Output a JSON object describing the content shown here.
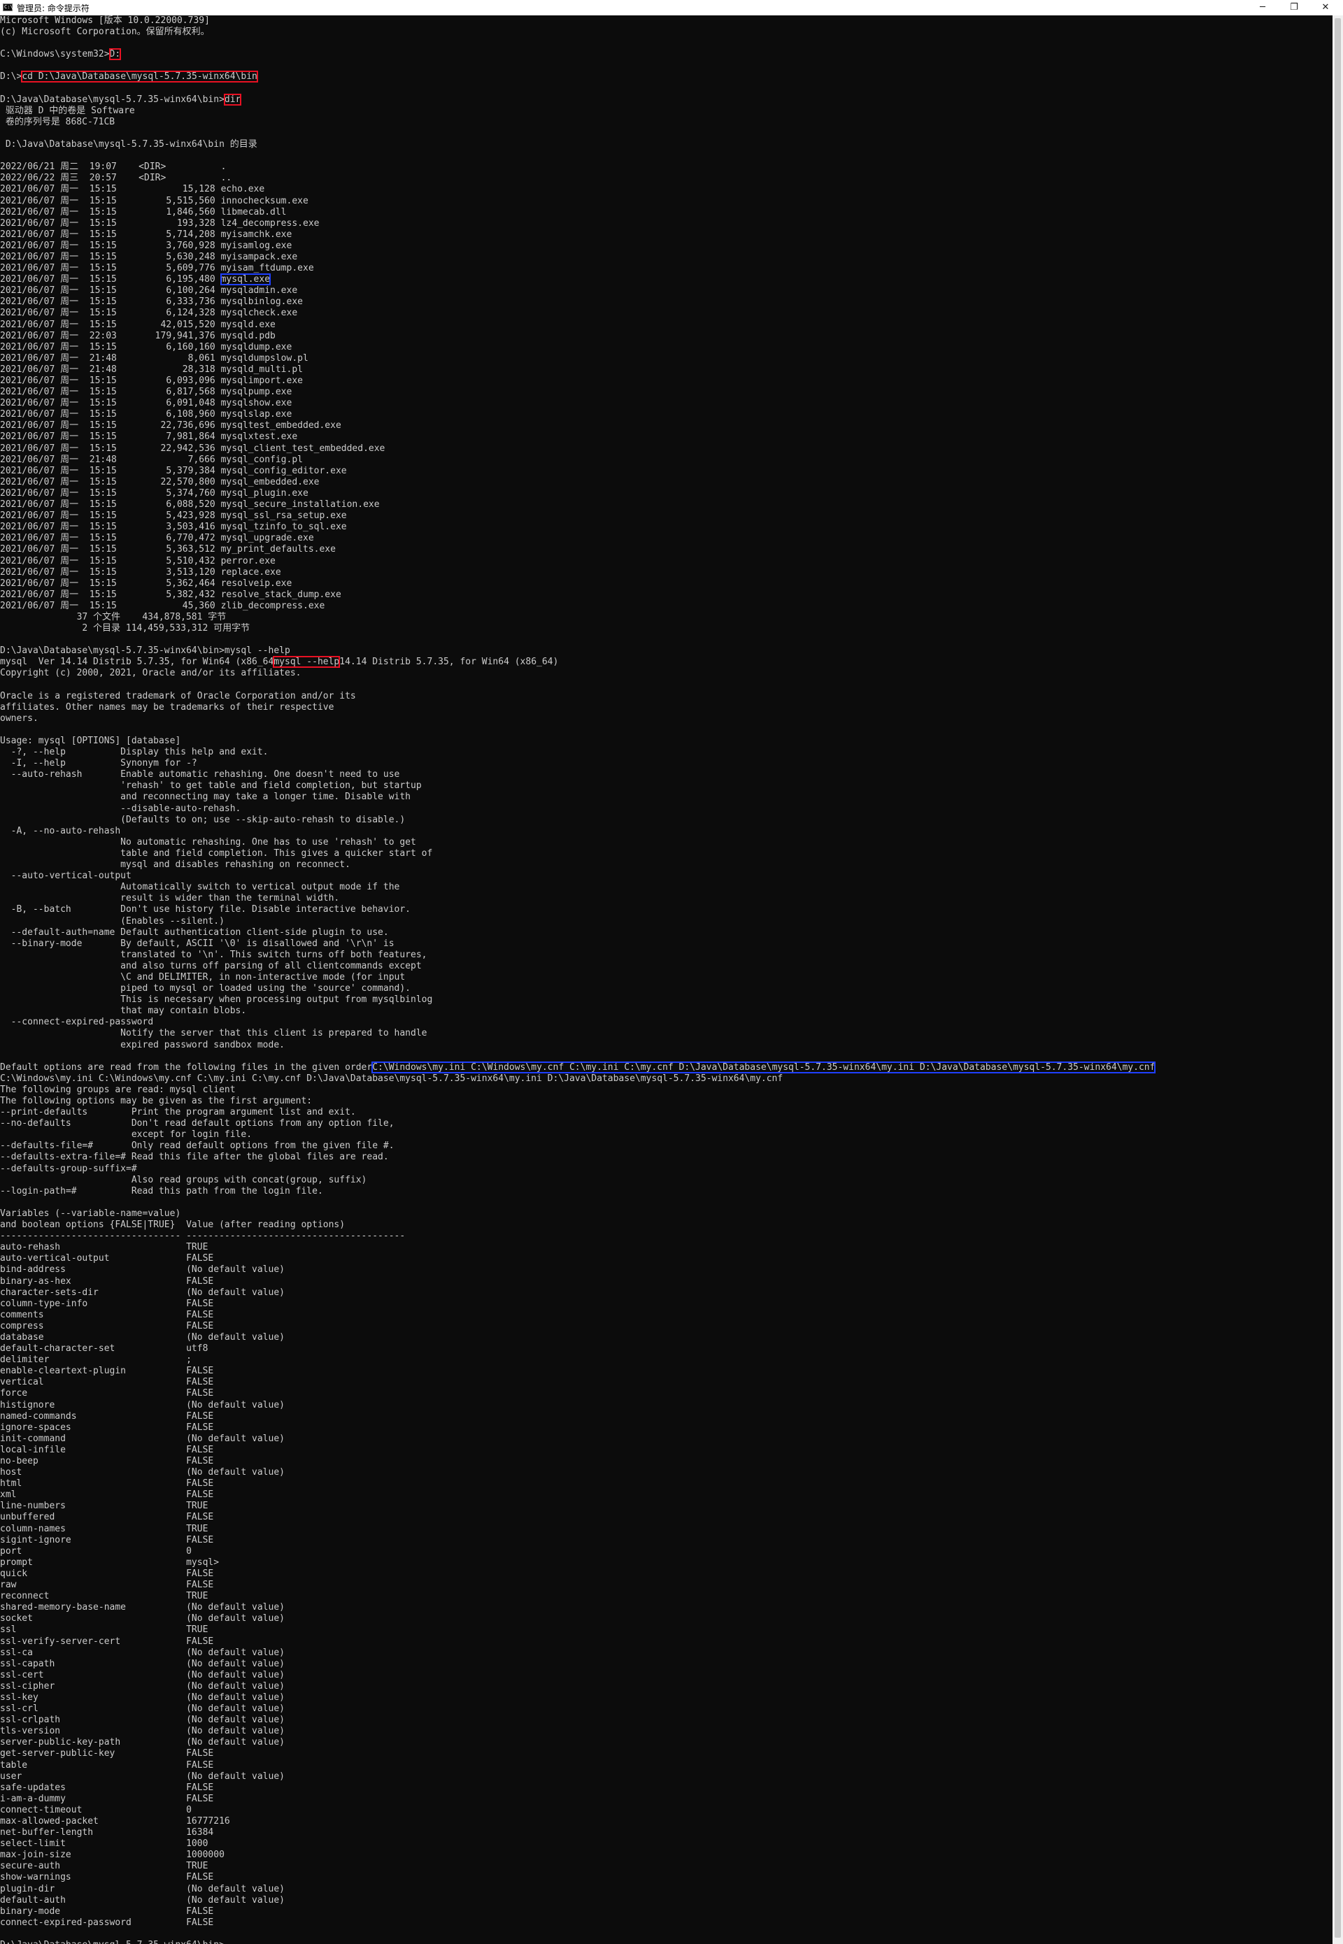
{
  "window": {
    "title": "管理员: 命令提示符",
    "icon_label": "C:\\",
    "minimize_glyph": "─",
    "maximize_glyph": "❐",
    "close_glyph": "✕"
  },
  "terminal": {
    "lines": [
      "Microsoft Windows [版本 10.0.22000.739]",
      "(c) Microsoft Corporation。保留所有权利。",
      "",
      "C:\\Windows\\system32>D:",
      "",
      "D:\\>cd D:\\Java\\Database\\mysql-5.7.35-winx64\\bin",
      "",
      "D:\\Java\\Database\\mysql-5.7.35-winx64\\bin>dir",
      " 驱动器 D 中的卷是 Software",
      " 卷的序列号是 868C-71CB",
      "",
      " D:\\Java\\Database\\mysql-5.7.35-winx64\\bin 的目录",
      "",
      "2022/06/21 周二  19:07    <DIR>          .",
      "2022/06/22 周三  20:57    <DIR>          ..",
      "2021/06/07 周一  15:15            15,128 echo.exe",
      "2021/06/07 周一  15:15         5,515,560 innochecksum.exe",
      "2021/06/07 周一  15:15         1,846,560 libmecab.dll",
      "2021/06/07 周一  15:15           193,328 lz4_decompress.exe",
      "2021/06/07 周一  15:15         5,714,208 myisamchk.exe",
      "2021/06/07 周一  15:15         3,760,928 myisamlog.exe",
      "2021/06/07 周一  15:15         5,630,248 myisampack.exe",
      "2021/06/07 周一  15:15         5,609,776 myisam_ftdump.exe",
      "2021/06/07 周一  15:15         6,195,480 mysql.exe",
      "2021/06/07 周一  15:15         6,100,264 mysqladmin.exe",
      "2021/06/07 周一  15:15         6,333,736 mysqlbinlog.exe",
      "2021/06/07 周一  15:15         6,124,328 mysqlcheck.exe",
      "2021/06/07 周一  15:15        42,015,520 mysqld.exe",
      "2021/06/07 周一  22:03       179,941,376 mysqld.pdb",
      "2021/06/07 周一  15:15         6,160,160 mysqldump.exe",
      "2021/06/07 周一  21:48             8,061 mysqldumpslow.pl",
      "2021/06/07 周一  21:48            28,318 mysqld_multi.pl",
      "2021/06/07 周一  15:15         6,093,096 mysqlimport.exe",
      "2021/06/07 周一  15:15         6,817,568 mysqlpump.exe",
      "2021/06/07 周一  15:15         6,091,048 mysqlshow.exe",
      "2021/06/07 周一  15:15         6,108,960 mysqlslap.exe",
      "2021/06/07 周一  15:15        22,736,696 mysqltest_embedded.exe",
      "2021/06/07 周一  15:15         7,981,864 mysqlxtest.exe",
      "2021/06/07 周一  15:15        22,942,536 mysql_client_test_embedded.exe",
      "2021/06/07 周一  21:48             7,666 mysql_config.pl",
      "2021/06/07 周一  15:15         5,379,384 mysql_config_editor.exe",
      "2021/06/07 周一  15:15        22,570,800 mysql_embedded.exe",
      "2021/06/07 周一  15:15         5,374,760 mysql_plugin.exe",
      "2021/06/07 周一  15:15         6,088,520 mysql_secure_installation.exe",
      "2021/06/07 周一  15:15         5,423,928 mysql_ssl_rsa_setup.exe",
      "2021/06/07 周一  15:15         3,503,416 mysql_tzinfo_to_sql.exe",
      "2021/06/07 周一  15:15         6,770,472 mysql_upgrade.exe",
      "2021/06/07 周一  15:15         5,363,512 my_print_defaults.exe",
      "2021/06/07 周一  15:15         5,510,432 perror.exe",
      "2021/06/07 周一  15:15         3,513,120 replace.exe",
      "2021/06/07 周一  15:15         5,362,464 resolveip.exe",
      "2021/06/07 周一  15:15         5,382,432 resolve_stack_dump.exe",
      "2021/06/07 周一  15:15            45,360 zlib_decompress.exe",
      "              37 个文件    434,878,581 字节",
      "               2 个目录 114,459,533,312 可用字节",
      "",
      "D:\\Java\\Database\\mysql-5.7.35-winx64\\bin>mysql --help",
      "mysql  Ver 14.14 Distrib 5.7.35, for Win64 (x86_64)",
      "Copyright (c) 2000, 2021, Oracle and/or its affiliates.",
      "",
      "Oracle is a registered trademark of Oracle Corporation and/or its",
      "affiliates. Other names may be trademarks of their respective",
      "owners.",
      "",
      "Usage: mysql [OPTIONS] [database]",
      "  -?, --help          Display this help and exit.",
      "  -I, --help          Synonym for -?",
      "  --auto-rehash       Enable automatic rehashing. One doesn't need to use",
      "                      'rehash' to get table and field completion, but startup",
      "                      and reconnecting may take a longer time. Disable with",
      "                      --disable-auto-rehash.",
      "                      (Defaults to on; use --skip-auto-rehash to disable.)",
      "  -A, --no-auto-rehash",
      "                      No automatic rehashing. One has to use 'rehash' to get",
      "                      table and field completion. This gives a quicker start of",
      "                      mysql and disables rehashing on reconnect.",
      "  --auto-vertical-output",
      "                      Automatically switch to vertical output mode if the",
      "                      result is wider than the terminal width.",
      "  -B, --batch         Don't use history file. Disable interactive behavior.",
      "                      (Enables --silent.)",
      "  --default-auth=name Default authentication client-side plugin to use.",
      "  --binary-mode       By default, ASCII '\\0' is disallowed and '\\r\\n' is",
      "                      translated to '\\n'. This switch turns off both features,",
      "                      and also turns off parsing of all clientcommands except",
      "                      \\C and DELIMITER, in non-interactive mode (for input",
      "                      piped to mysql or loaded using the 'source' command).",
      "                      This is necessary when processing output from mysqlbinlog",
      "                      that may contain blobs.",
      "  --connect-expired-password",
      "                      Notify the server that this client is prepared to handle",
      "                      expired password sandbox mode.",
      "",
      "Default options are read from the following files in the given order:",
      "C:\\Windows\\my.ini C:\\Windows\\my.cnf C:\\my.ini C:\\my.cnf D:\\Java\\Database\\mysql-5.7.35-winx64\\my.ini D:\\Java\\Database\\mysql-5.7.35-winx64\\my.cnf",
      "The following groups are read: mysql client",
      "The following options may be given as the first argument:",
      "--print-defaults        Print the program argument list and exit.",
      "--no-defaults           Don't read default options from any option file,",
      "                        except for login file.",
      "--defaults-file=#       Only read default options from the given file #.",
      "--defaults-extra-file=# Read this file after the global files are read.",
      "--defaults-group-suffix=#",
      "                        Also read groups with concat(group, suffix)",
      "--login-path=#          Read this path from the login file.",
      "",
      "Variables (--variable-name=value)",
      "and boolean options {FALSE|TRUE}  Value (after reading options)",
      "--------------------------------- ----------------------------------------",
      "auto-rehash                       TRUE",
      "auto-vertical-output              FALSE",
      "bind-address                      (No default value)",
      "binary-as-hex                     FALSE",
      "character-sets-dir                (No default value)",
      "column-type-info                  FALSE",
      "comments                          FALSE",
      "compress                          FALSE",
      "database                          (No default value)",
      "default-character-set             utf8",
      "delimiter                         ;",
      "enable-cleartext-plugin           FALSE",
      "vertical                          FALSE",
      "force                             FALSE",
      "histignore                        (No default value)",
      "named-commands                    FALSE",
      "ignore-spaces                     FALSE",
      "init-command                      (No default value)",
      "local-infile                      FALSE",
      "no-beep                           FALSE",
      "host                              (No default value)",
      "html                              FALSE",
      "xml                               FALSE",
      "line-numbers                      TRUE",
      "unbuffered                        FALSE",
      "column-names                      TRUE",
      "sigint-ignore                     FALSE",
      "port                              0",
      "prompt                            mysql>",
      "quick                             FALSE",
      "raw                               FALSE",
      "reconnect                         TRUE",
      "shared-memory-base-name           (No default value)",
      "socket                            (No default value)",
      "ssl                               TRUE",
      "ssl-verify-server-cert            FALSE",
      "ssl-ca                            (No default value)",
      "ssl-capath                        (No default value)",
      "ssl-cert                          (No default value)",
      "ssl-cipher                        (No default value)",
      "ssl-key                           (No default value)",
      "ssl-crl                           (No default value)",
      "ssl-crlpath                       (No default value)",
      "tls-version                       (No default value)",
      "server-public-key-path            (No default value)",
      "get-server-public-key             FALSE",
      "table                             FALSE",
      "user                              (No default value)",
      "safe-updates                      FALSE",
      "i-am-a-dummy                      FALSE",
      "connect-timeout                   0",
      "max-allowed-packet                16777216",
      "net-buffer-length                 16384",
      "select-limit                      1000",
      "max-join-size                     1000000",
      "secure-auth                       TRUE",
      "show-warnings                     FALSE",
      "plugin-dir                        (No default value)",
      "default-auth                      (No default value)",
      "binary-mode                       FALSE",
      "connect-expired-password          FALSE",
      "",
      "D:\\Java\\Database\\mysql-5.7.35-winx64\\bin>"
    ],
    "highlights": [
      {
        "line": 3,
        "text": "D:",
        "style": "red"
      },
      {
        "line": 5,
        "text": "cd D:\\Java\\Database\\mysql-5.7.35-winx64\\bin",
        "style": "red"
      },
      {
        "line": 7,
        "text": "dir",
        "style": "red"
      },
      {
        "line": 23,
        "text": "mysql.exe",
        "style": "blue"
      },
      {
        "line": 57,
        "text": "mysql --help",
        "style": "red"
      },
      {
        "line": 93,
        "text": "C:\\Windows\\my.ini C:\\Windows\\my.cnf C:\\my.ini C:\\my.cnf D:\\Java\\Database\\mysql-5.7.35-winx64\\my.ini D:\\Java\\Database\\mysql-5.7.35-winx64\\my.cnf",
        "style": "blue"
      }
    ]
  },
  "colors": {
    "background": "#0c0c0c",
    "foreground": "#cccccc",
    "highlight_red": "#e81123",
    "highlight_blue": "#1f3fff"
  }
}
